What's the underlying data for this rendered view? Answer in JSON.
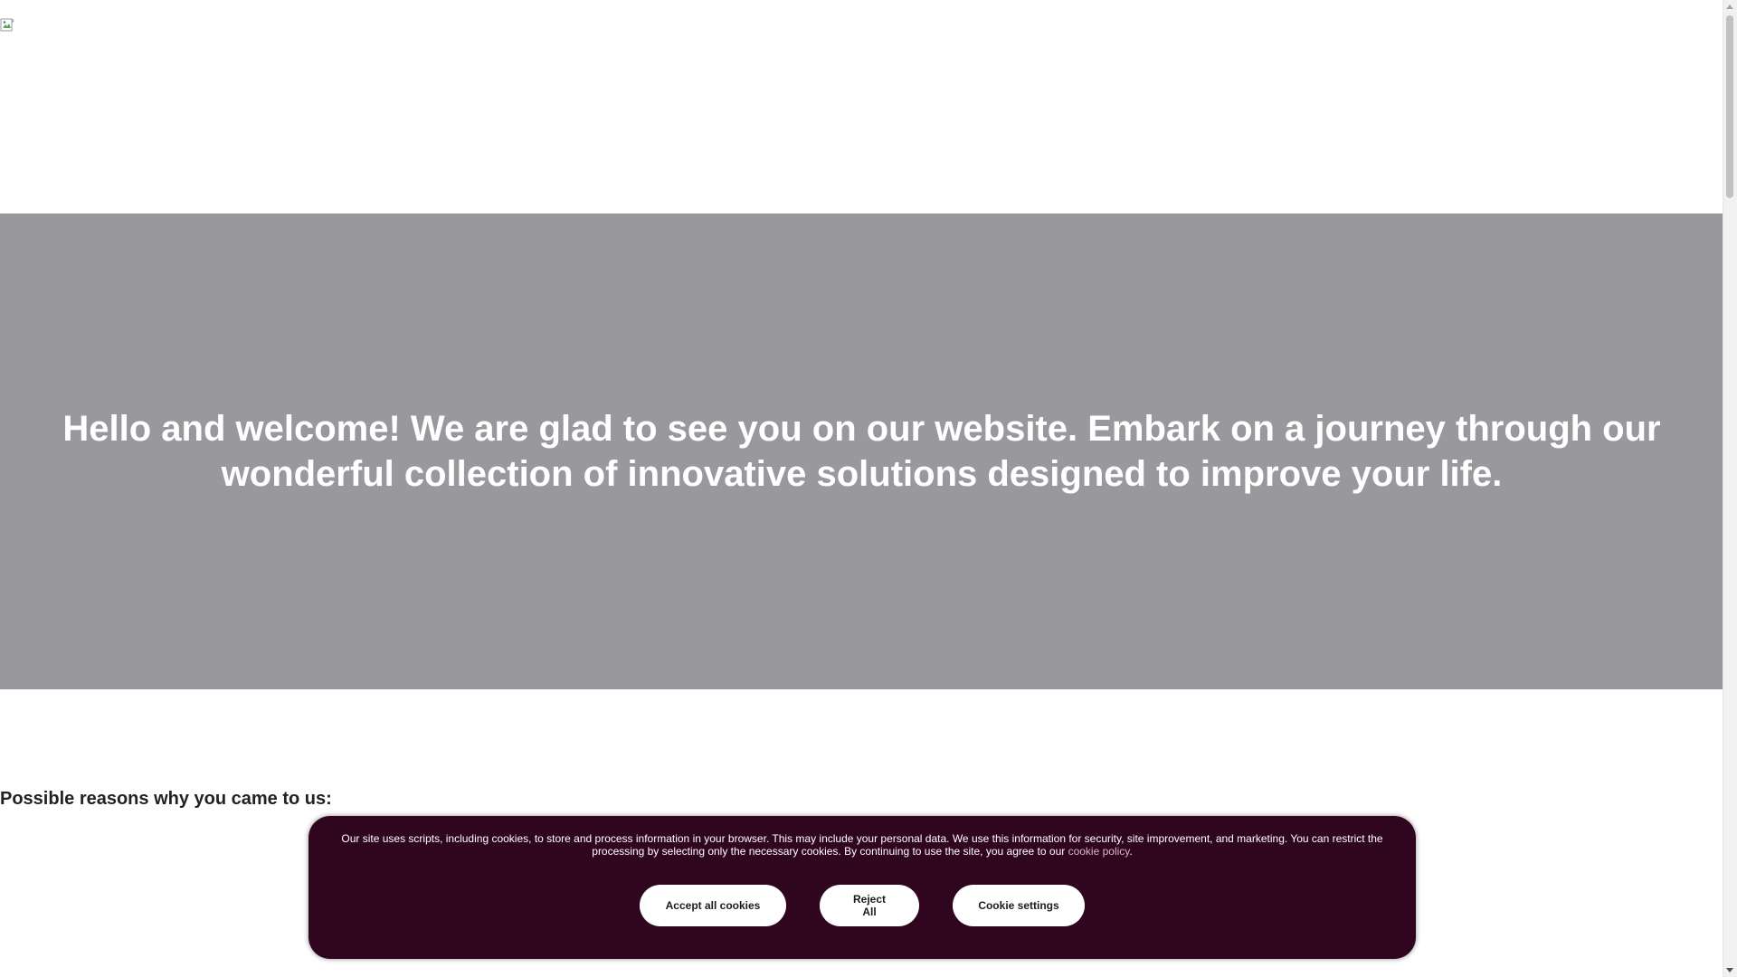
{
  "header": {
    "logo_alt": ""
  },
  "hero": {
    "title": "Hello and welcome! We are glad to see you on our website. Embark on a journey through our wonderful collection of innovative solutions designed to improve your life.",
    "background_color": "#98989d"
  },
  "main": {
    "section_heading": "Possible reasons why you came to us:"
  },
  "cookie_banner": {
    "text": "Our site uses scripts, including cookies, to store and process information in your browser. This may include your personal data. We use this information for security, site improvement, and marketing. You can restrict the processing by selecting only the necessary cookies. By continuing to use the site, you agree to our ",
    "policy_link": "cookie policy",
    "text_end": ".",
    "background_color": "#300520",
    "buttons": {
      "accept": "Accept all cookies",
      "reject": "Reject All",
      "settings": "Cookie settings"
    }
  }
}
